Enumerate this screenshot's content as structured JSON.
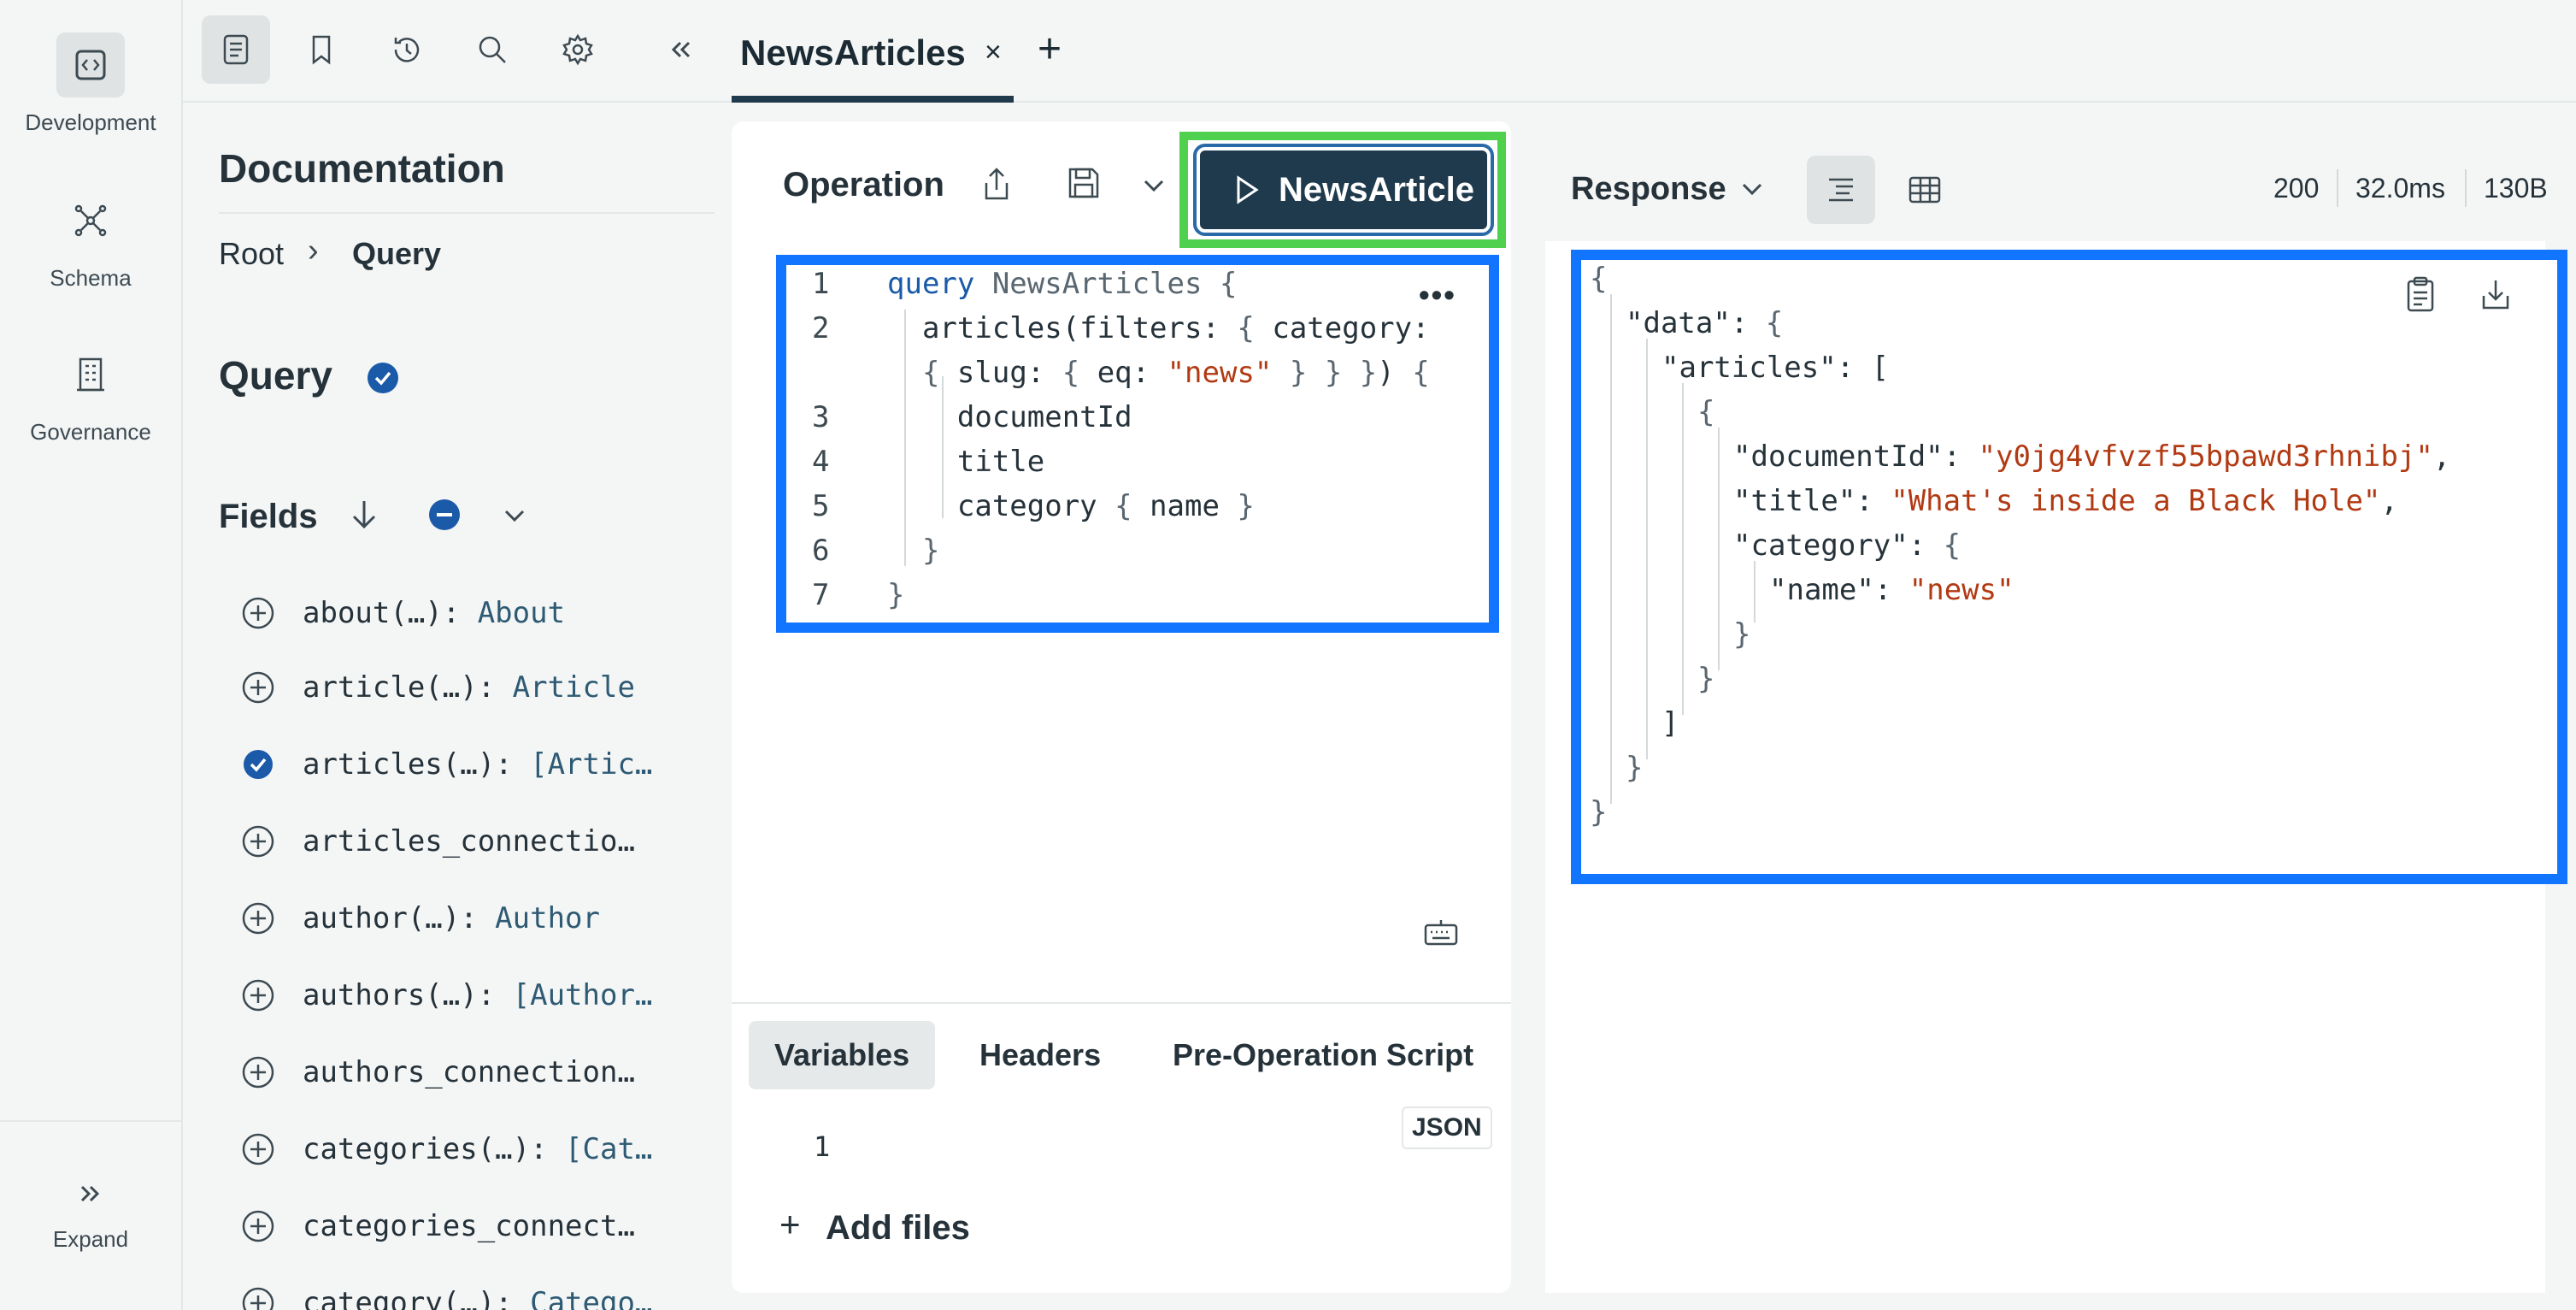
{
  "rail": {
    "items": [
      {
        "label": "Development",
        "icon": "code-icon"
      },
      {
        "label": "Schema",
        "icon": "graph-icon"
      },
      {
        "label": "Governance",
        "icon": "building-icon"
      }
    ],
    "expand_label": "Expand"
  },
  "tab": {
    "title": "NewsArticles",
    "close": "×",
    "add": "+"
  },
  "docs": {
    "title": "Documentation",
    "breadcrumb": {
      "root": "Root",
      "sep": "›",
      "current": "Query"
    },
    "heading": "Query",
    "fields_label": "Fields",
    "fields": [
      {
        "name": "about(…): ",
        "type": "About",
        "selected": false
      },
      {
        "name": "article(…): ",
        "type": "Article",
        "selected": false
      },
      {
        "name": "articles(…): ",
        "type": "[Artic…",
        "selected": true
      },
      {
        "name": "articles_connectio…",
        "type": "",
        "selected": false
      },
      {
        "name": "author(…): ",
        "type": "Author",
        "selected": false
      },
      {
        "name": "authors(…): ",
        "type": "[Author…",
        "selected": false
      },
      {
        "name": "authors_connection…",
        "type": "",
        "selected": false
      },
      {
        "name": "categories(…): ",
        "type": "[Cat…",
        "selected": false
      },
      {
        "name": "categories_connect…",
        "type": "",
        "selected": false
      },
      {
        "name": "category(…): ",
        "type": "Catego…",
        "selected": false
      }
    ]
  },
  "operation": {
    "title": "Operation",
    "run_label": "NewsArticle",
    "code_lines": [
      {
        "n": "1",
        "parts": [
          [
            "kw",
            "query "
          ],
          [
            "nm",
            "NewsArticles "
          ],
          [
            "pn",
            "{"
          ]
        ]
      },
      {
        "n": "2",
        "parts": [
          [
            "",
            "  articles(filters: "
          ],
          [
            "pn",
            "{ "
          ],
          [
            "",
            "category:"
          ]
        ]
      },
      {
        "n": "",
        "parts": [
          [
            "",
            "  "
          ],
          [
            "pn",
            "{ "
          ],
          [
            "",
            "slug: "
          ],
          [
            "pn",
            "{ "
          ],
          [
            "",
            "eq: "
          ],
          [
            "st",
            "\"news\""
          ],
          [
            "pn",
            " } } }"
          ],
          [
            "",
            ") "
          ],
          [
            "pn",
            "{"
          ]
        ]
      },
      {
        "n": "3",
        "parts": [
          [
            "",
            "    documentId"
          ]
        ]
      },
      {
        "n": "4",
        "parts": [
          [
            "",
            "    title"
          ]
        ]
      },
      {
        "n": "5",
        "parts": [
          [
            "",
            "    category "
          ],
          [
            "pn",
            "{ "
          ],
          [
            "",
            "name "
          ],
          [
            "pn",
            "}"
          ]
        ]
      },
      {
        "n": "6",
        "parts": [
          [
            "pn",
            "  }"
          ]
        ]
      },
      {
        "n": "7",
        "parts": [
          [
            "pn",
            "}"
          ]
        ]
      }
    ],
    "more": "•••",
    "sub_tabs": [
      "Variables",
      "Headers",
      "Pre-Operation Script"
    ],
    "variables_line": "1",
    "json_badge": "JSON",
    "add_files": "Add files",
    "add_plus": "+"
  },
  "response": {
    "title": "Response",
    "status": "200",
    "time": "32.0ms",
    "size": "130B",
    "lines": [
      {
        "indent": 0,
        "parts": [
          [
            "pn",
            "{"
          ]
        ]
      },
      {
        "indent": 1,
        "parts": [
          [
            "",
            "\"data\": "
          ],
          [
            "pn",
            "{"
          ]
        ]
      },
      {
        "indent": 2,
        "parts": [
          [
            "",
            "\"articles\": ["
          ]
        ]
      },
      {
        "indent": 3,
        "parts": [
          [
            "pn",
            "{"
          ]
        ]
      },
      {
        "indent": 4,
        "parts": [
          [
            "",
            "\"documentId\": "
          ],
          [
            "st",
            "\"y0jg4vfvzf55bpawd3rhnibj\""
          ],
          [
            "",
            ","
          ]
        ]
      },
      {
        "indent": 4,
        "parts": [
          [
            "",
            "\"title\": "
          ],
          [
            "st",
            "\"What's inside a Black Hole\""
          ],
          [
            "",
            ","
          ]
        ]
      },
      {
        "indent": 4,
        "parts": [
          [
            "",
            "\"category\": "
          ],
          [
            "pn",
            "{"
          ]
        ]
      },
      {
        "indent": 5,
        "parts": [
          [
            "",
            "\"name\": "
          ],
          [
            "st",
            "\"news\""
          ]
        ]
      },
      {
        "indent": 4,
        "parts": [
          [
            "pn",
            "}"
          ]
        ]
      },
      {
        "indent": 3,
        "parts": [
          [
            "pn",
            "}"
          ]
        ]
      },
      {
        "indent": 2,
        "parts": [
          [
            "",
            "]"
          ]
        ]
      },
      {
        "indent": 1,
        "parts": [
          [
            "pn",
            "}"
          ]
        ]
      },
      {
        "indent": 0,
        "parts": [
          [
            "pn",
            "}"
          ]
        ]
      }
    ]
  },
  "colors": {
    "accent": "#1e3a4c",
    "highlight_blue": "#1175ff",
    "highlight_green": "#4fd04f",
    "string": "#b23a13",
    "keyword": "#1a5aa8"
  }
}
